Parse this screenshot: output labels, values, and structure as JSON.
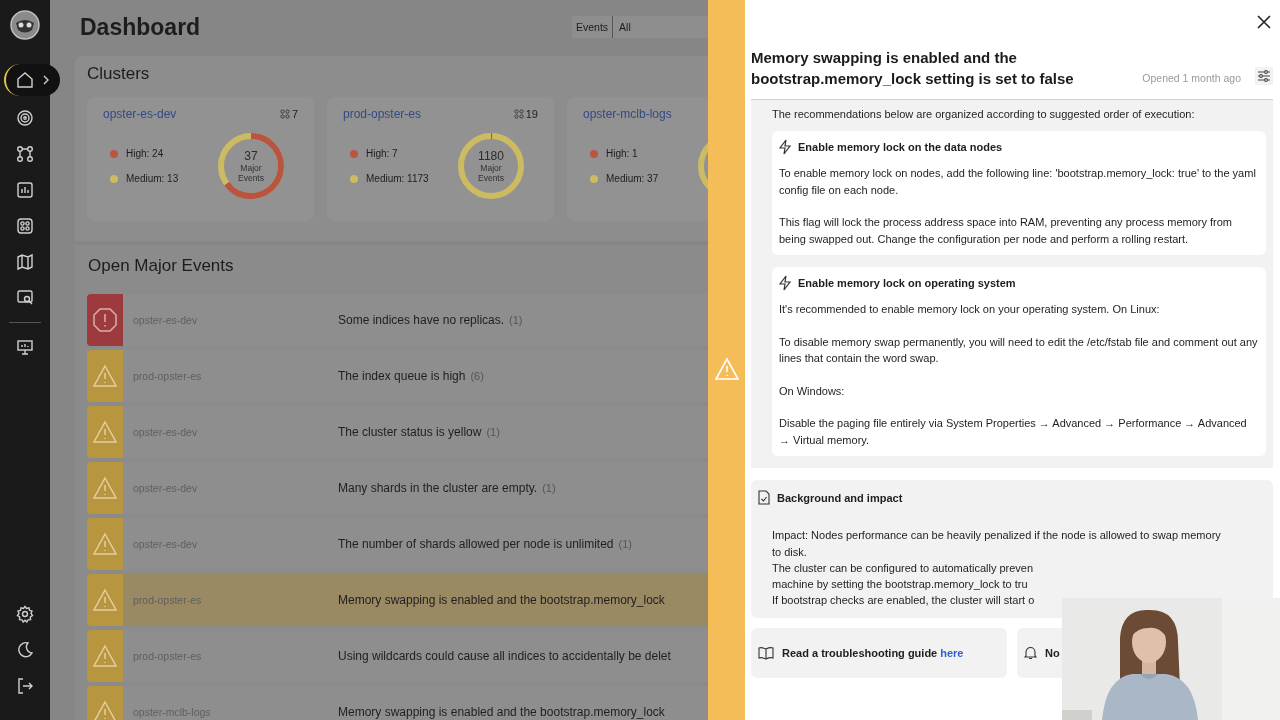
{
  "sidebar": {
    "items": [
      {
        "kind": "home",
        "selected": true
      },
      {
        "kind": "target",
        "selected": false
      },
      {
        "kind": "nodes",
        "selected": false
      },
      {
        "kind": "chart",
        "selected": false
      },
      {
        "kind": "grid",
        "selected": false
      },
      {
        "kind": "map",
        "selected": false
      },
      {
        "kind": "monitor-search",
        "selected": false
      },
      {
        "kind": "presentation",
        "selected": false
      }
    ],
    "bottom_items": [
      {
        "kind": "settings"
      },
      {
        "kind": "moon"
      },
      {
        "kind": "logout"
      }
    ]
  },
  "header": {
    "title": "Dashboard",
    "filter": {
      "label": "Events",
      "value": "All"
    }
  },
  "clusters": {
    "title": "Clusters",
    "cards": [
      {
        "name": "opster-es-dev",
        "nodes": "7",
        "legend": [
          {
            "label": "High: 24",
            "color": "#b8543f"
          },
          {
            "label": "Medium: 13",
            "color": "#cdbb62"
          }
        ],
        "total": "37",
        "total_label": "Major Events",
        "donut": {
          "level": 0.649
        }
      },
      {
        "name": "prod-opster-es",
        "nodes": "19",
        "legend": [
          {
            "label": "High: 7",
            "color": "#b8543f"
          },
          {
            "label": "Medium: 1173",
            "color": "#cdbb62"
          }
        ],
        "total": "1180",
        "total_label": "Major Events",
        "donut": {
          "level": 0.006
        }
      },
      {
        "name": "opster-mclb-logs",
        "legend": [
          {
            "label": "High: 1",
            "color": "#b8543f"
          },
          {
            "label": "Medium: 37",
            "color": "#cdbb62"
          }
        ]
      }
    ]
  },
  "events": {
    "title": "Open Major Events",
    "rows": [
      {
        "kind": "critical",
        "cluster": "opster-es-dev",
        "message": "Some indices have no replicas.",
        "count": "(1)",
        "selected": false
      },
      {
        "kind": "warning",
        "cluster": "prod-opster-es",
        "message": "The index queue is high",
        "count": "(6)",
        "selected": false
      },
      {
        "kind": "warning",
        "cluster": "opster-es-dev",
        "message": "The cluster status is yellow",
        "count": "(1)",
        "selected": false
      },
      {
        "kind": "warning",
        "cluster": "opster-es-dev",
        "message": "Many shards in the cluster are empty.",
        "count": "(1)",
        "selected": false
      },
      {
        "kind": "warning",
        "cluster": "opster-es-dev",
        "message": "The number of shards allowed per node is unlimited",
        "count": "(1)",
        "selected": false
      },
      {
        "kind": "warning",
        "cluster": "prod-opster-es",
        "message": "Memory swapping is enabled and the bootstrap.memory_lock",
        "selected": true
      },
      {
        "kind": "warning",
        "cluster": "prod-opster-es",
        "message": "Using wildcards could cause all indices to accidentally be delet",
        "selected": false
      },
      {
        "kind": "warning",
        "cluster": "opster-mclb-logs",
        "message": "Memory swapping is enabled and the bootstrap.memory_lock",
        "selected": false
      }
    ]
  },
  "drawer": {
    "kind": "warning",
    "title": "Memory swapping is enabled and the bootstrap.memory_lock setting is set to false",
    "opened": "Opened 1 month ago",
    "intro": "The recommendations below are organized according to suggested order of execution:",
    "recommendations": [
      {
        "title": "Enable memory lock on the data nodes",
        "paragraphs": [
          "To enable memory lock on nodes, add the following line: 'bootstrap.memory_lock: true' to the yaml config file on each node.",
          "This flag will lock the process address space into RAM, preventing any process memory from being swapped out. Change the configuration per node and perform a rolling restart."
        ]
      },
      {
        "title": "Enable memory lock on operating system",
        "paragraphs": [
          "It's recommended to enable memory lock on your operating system. On Linux:",
          "To disable memory swap permanently, you will need to edit the /etc/fstab file and comment out any lines that contain the word swap.",
          "On Windows:",
          "Disable the paging file entirely via System Properties → Advanced → Performance → Advanced → Virtual memory."
        ]
      }
    ],
    "background": {
      "title": "Background and impact",
      "paragraph": "Impact: Nodes performance can be heavily penalized if the node is allowed to swap memory to disk.",
      "lines": [
        "The cluster can be configured to automatically preven",
        "machine by setting the bootstrap.memory_lock to tru",
        "If bootstrap checks are enabled, the cluster will start o"
      ]
    },
    "links": [
      {
        "kind": "guide",
        "text": "Read a troubleshooting guide",
        "link": "here"
      },
      {
        "kind": "notify",
        "text": "No"
      }
    ]
  }
}
